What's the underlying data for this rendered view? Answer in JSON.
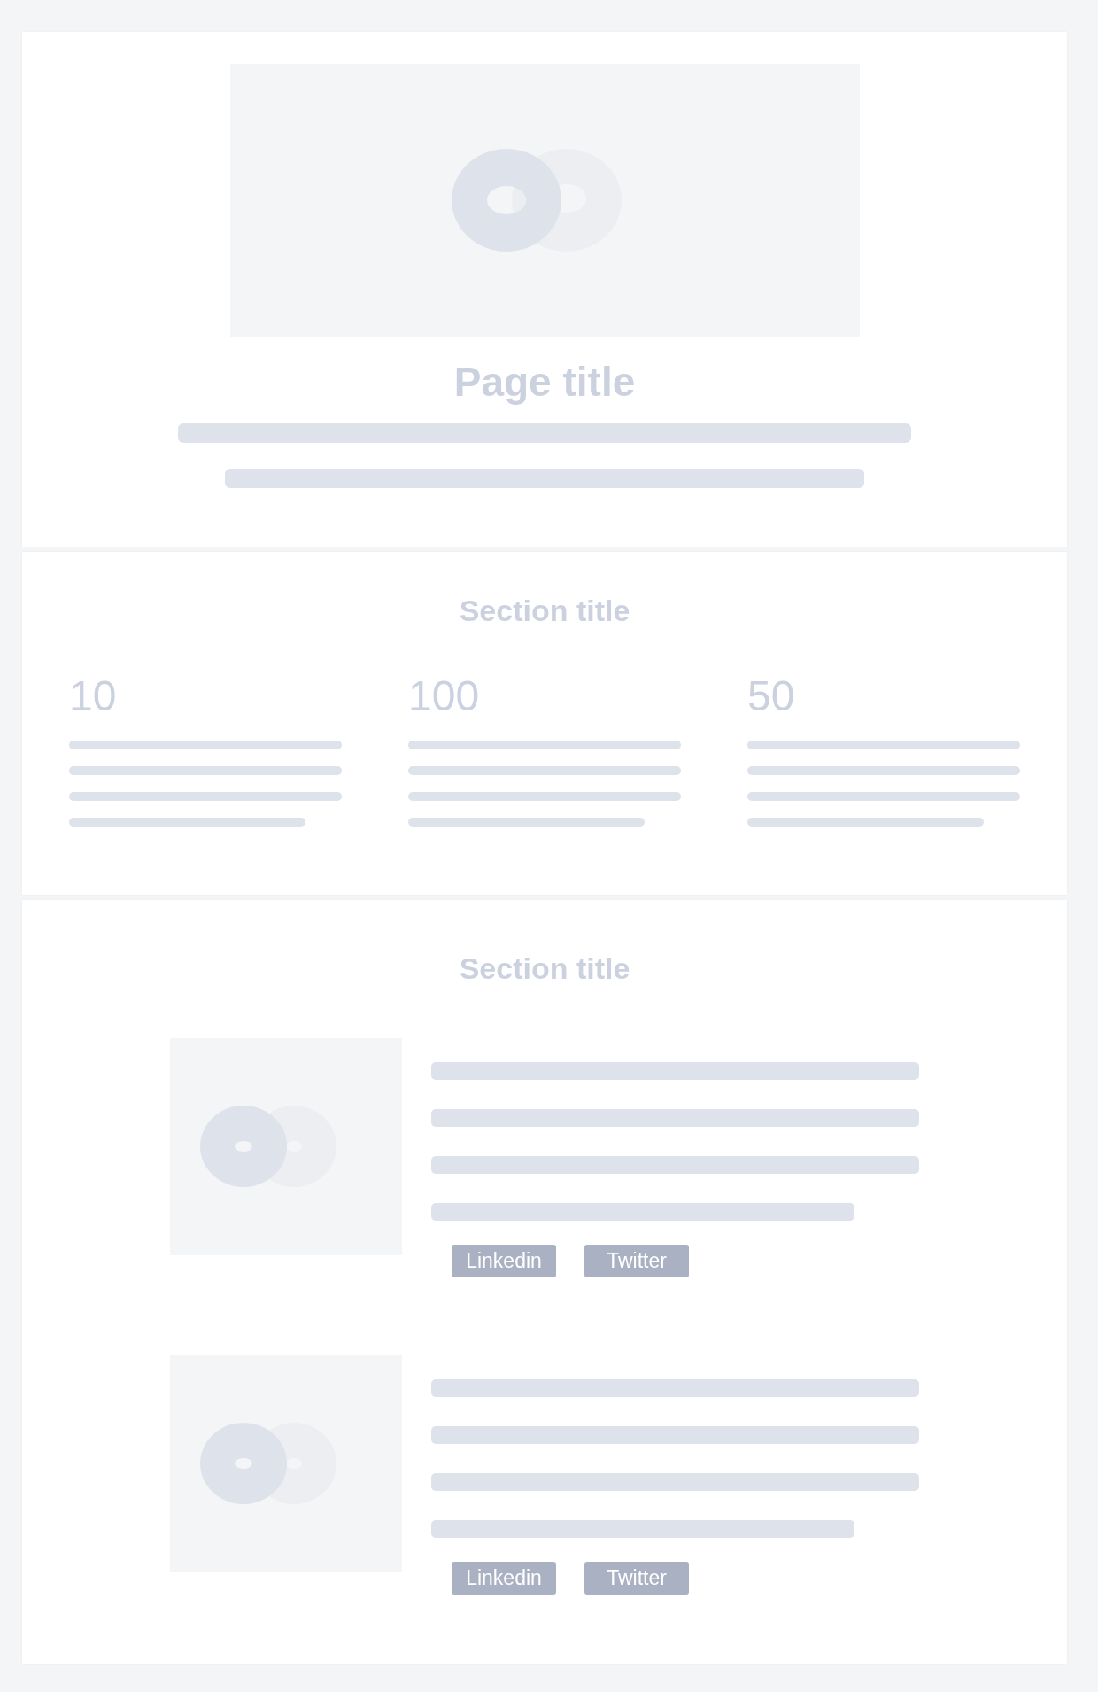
{
  "header": {
    "title": "Page title"
  },
  "stats": {
    "title": "Section title",
    "items": [
      {
        "value": "10"
      },
      {
        "value": "100"
      },
      {
        "value": "50"
      }
    ]
  },
  "people": {
    "title": "Section title",
    "items": [
      {
        "tags": [
          "Linkedin",
          "Twitter"
        ]
      },
      {
        "tags": [
          "Linkedin",
          "Twitter"
        ]
      }
    ]
  }
}
